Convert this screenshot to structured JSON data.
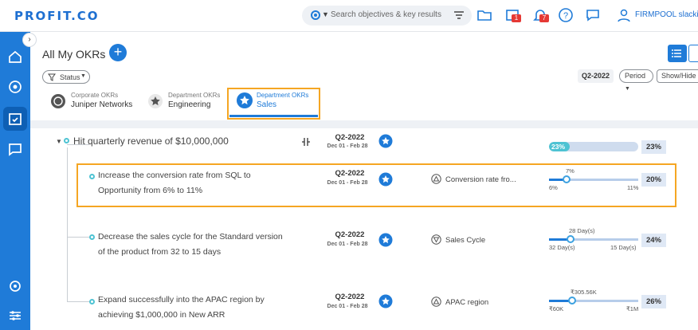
{
  "topbar": {
    "logo": "PROFIT.CO",
    "search_placeholder": "Search objectives & key results",
    "badge_1": "1",
    "badge_2": "7",
    "username": "FIRMPOOL slacki..."
  },
  "page": {
    "title": "All My OKRs",
    "status_filter": "Status",
    "period_code": "Q2-2022",
    "period_label": "Period",
    "show_hide_label": "Show/Hide"
  },
  "tabs": [
    {
      "sub": "Corporate OKRs",
      "name": "Juniper Networks"
    },
    {
      "sub": "Department OKRs",
      "name": "Engineering"
    },
    {
      "sub": "Department OKRs",
      "name": "Sales"
    }
  ],
  "objective": {
    "title": "Hit quarterly revenue of $10,000,000",
    "quarter": "Q2-2022",
    "dates": "Dec 01 - Feb 28",
    "progress_label": "23%",
    "progress_value": 0.23,
    "score": "23%"
  },
  "key_results": [
    {
      "line1": "Increase the conversion rate from SQL to",
      "line2": "Opportunity from 6% to 11%",
      "quarter": "Q2-2022",
      "dates": "Dec 01 - Feb 28",
      "metric": "Conversion rate fro...",
      "current": "7%",
      "start": "6%",
      "target": "11%",
      "fraction": 0.2,
      "score": "20%"
    },
    {
      "line1": "Decrease the sales cycle for the Standard version",
      "line2": "of the product from 32 to 15 days",
      "quarter": "Q2-2022",
      "dates": "Dec 01 - Feb 28",
      "metric": "Sales Cycle",
      "current": "28 Day(s)",
      "start": "32 Day(s)",
      "target": "15 Day(s)",
      "fraction": 0.24,
      "score": "24%"
    },
    {
      "line1": "Expand successfully into the APAC region by",
      "line2": "achieving $1,000,000 in New ARR",
      "quarter": "Q2-2022",
      "dates": "Dec 01 - Feb 28",
      "metric": "APAC region",
      "current": "₹305.56K",
      "start": "₹60K",
      "target": "₹1M",
      "fraction": 0.26,
      "score": "26%"
    }
  ],
  "colors": {
    "brand_blue": "#1f7bd8",
    "highlight_orange": "#f5a623",
    "teal_dot": "#4ec3d3"
  }
}
